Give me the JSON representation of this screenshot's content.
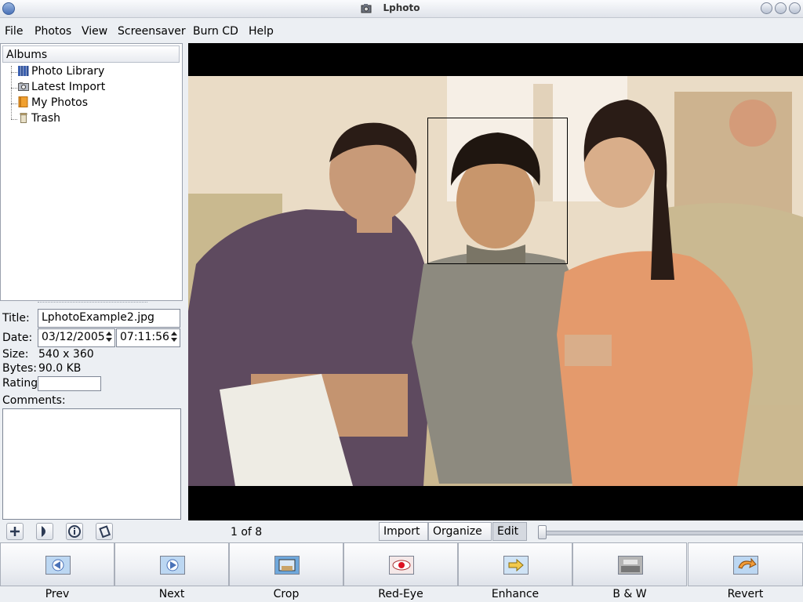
{
  "window": {
    "title": "Lphoto"
  },
  "menu": [
    "File",
    "Photos",
    "View",
    "Screensaver",
    "Burn CD",
    "Help"
  ],
  "albums": {
    "header": "Albums",
    "items": [
      {
        "label": "Photo Library",
        "icon": "library-icon"
      },
      {
        "label": "Latest Import",
        "icon": "camera-icon"
      },
      {
        "label": "My Photos",
        "icon": "album-icon"
      },
      {
        "label": "Trash",
        "icon": "trash-icon"
      }
    ]
  },
  "info": {
    "title_label": "Title:",
    "title_value": "LphotoExample2.jpg",
    "date_label": "Date:",
    "date_value": "03/12/2005",
    "time_value": "07:11:56",
    "size_label": "Size:",
    "size_value": "540 x 360",
    "bytes_label": "Bytes:",
    "bytes_value": "90.0 KB",
    "rating_label": "Rating:",
    "rating_value": "",
    "comments_label": "Comments:",
    "comments_value": ""
  },
  "status": {
    "count": "1 of 8"
  },
  "modes": [
    "Import",
    "Organize",
    "Edit"
  ],
  "active_mode": "Edit",
  "tools": [
    "Prev",
    "Next",
    "Crop",
    "Red-Eye",
    "Enhance",
    "B & W",
    "Revert"
  ],
  "colors": {
    "accent": "#4a72b8",
    "photo_frame": "#000000"
  }
}
